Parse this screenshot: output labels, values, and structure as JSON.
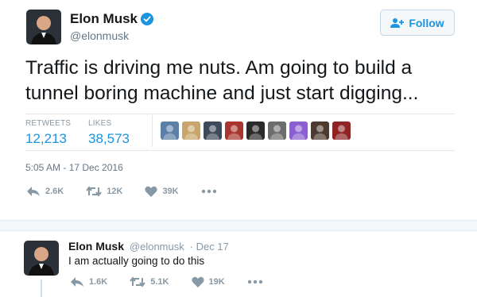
{
  "tweet": {
    "author_name": "Elon Musk",
    "handle": "@elonmusk",
    "follow_label": "Follow",
    "text": "Traffic is driving me nuts. Am going to build a tunnel boring machine and just start digging...",
    "stats": {
      "retweets_label": "RETWEETS",
      "retweets_value": "12,213",
      "likes_label": "LIKES",
      "likes_value": "38,573"
    },
    "timestamp": "5:05 AM - 17 Dec 2016",
    "actions": {
      "reply_count": "2.6K",
      "retweet_count": "12K",
      "like_count": "39K"
    }
  },
  "reply": {
    "author_name": "Elon Musk",
    "handle": "@elonmusk",
    "date": "· Dec 17",
    "text": "I am actually going to do this",
    "actions": {
      "reply_count": "1.6K",
      "retweet_count": "5.1K",
      "like_count": "19K"
    }
  },
  "colors": {
    "accent": "#1c94e0",
    "muted": "#8899a6",
    "divider": "#e1e8ed"
  },
  "likers": [
    {
      "color": "#5b7fa6"
    },
    {
      "color": "#c9a46b"
    },
    {
      "color": "#3e4a5a"
    },
    {
      "color": "#a8352e"
    },
    {
      "color": "#2a2a2a"
    },
    {
      "color": "#6d6d6d"
    },
    {
      "color": "#8a5fd0"
    },
    {
      "color": "#4c3b2e"
    },
    {
      "color": "#8e2424"
    }
  ]
}
